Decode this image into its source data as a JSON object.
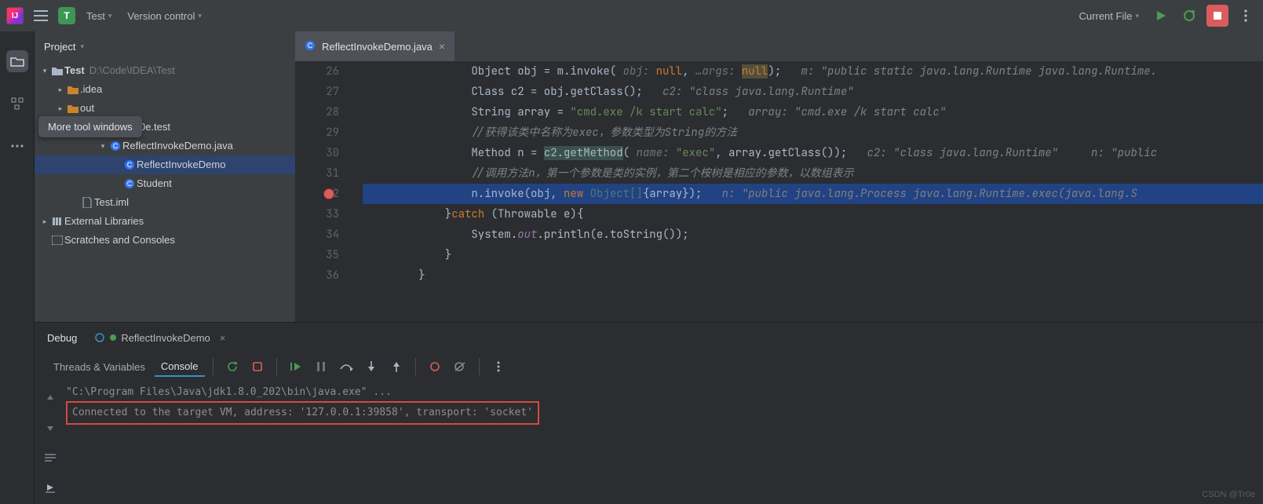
{
  "titlebar": {
    "project_badge": "T",
    "project_name": "Test",
    "vcs_label": "Version control",
    "run_config": "Current File"
  },
  "left_rail": {
    "tooltip": "More tool windows"
  },
  "project_tool": {
    "title": "Project",
    "tree": {
      "root_name": "Test",
      "root_path": "D:\\Code\\IDEA\\Test",
      "idea": ".idea",
      "out": "out",
      "pkg": "com.Tr0e.test",
      "file_java": "ReflectInvokeDemo.java",
      "cls_demo": "ReflectInvokeDemo",
      "cls_student": "Student",
      "iml": "Test.iml",
      "ext_libs": "External Libraries",
      "scratches": "Scratches and Consoles"
    }
  },
  "editor": {
    "tab_name": "ReflectInvokeDemo.java",
    "lines": {
      "26": {
        "indent": "                ",
        "pre": "Object obj = m.invoke( ",
        "p1": "obj: ",
        "v1": "null",
        "sep": ", ",
        "p2": "…args: ",
        "v2": "null",
        "post": ");   ",
        "hint": "m: \"public static java.lang.Runtime java.lang.Runtime."
      },
      "27": {
        "indent": "                ",
        "code": "Class c2 = obj.getClass();   ",
        "hint": "c2: \"class java.lang.Runtime\""
      },
      "28": {
        "indent": "                ",
        "pre": "String array = ",
        "str": "\"cmd.exe /k start calc\"",
        "post": ";   ",
        "hint": "array: \"cmd.exe /k start calc\""
      },
      "29": {
        "indent": "                ",
        "cmt": "//获得该类中名称为exec，参数类型为String的方法"
      },
      "30": {
        "indent": "                ",
        "pre": "Method n = ",
        "call": "c2.getMethod",
        "paren": "( ",
        "p1": "name: ",
        "str": "\"exec\"",
        "post": ", array.getClass());   ",
        "hint": "c2: \"class java.lang.Runtime\"     n: \"public"
      },
      "31": {
        "indent": "                ",
        "cmt": "//调用方法n，第一个参数是类的实例，第二个桉树是相应的参数，以数组表示"
      },
      "32": {
        "indent": "                ",
        "pre": "n.invoke(obj, ",
        "kw": "new ",
        "type": "Object[]",
        "post": "{array});   ",
        "hint": "n: \"public java.lang.Process java.lang.Runtime.exec(java.lang.S"
      },
      "33": {
        "indent": "            ",
        "pre": "}",
        "kw": "catch ",
        "post": "(Throwable e){"
      },
      "34": {
        "indent": "                ",
        "pre": "System.",
        "fld": "out",
        "post": ".println(e.toString());"
      },
      "35": {
        "indent": "            ",
        "txt": "}"
      },
      "36": {
        "indent": "        ",
        "txt": "}"
      }
    }
  },
  "debug": {
    "title": "Debug",
    "run_tab": "ReflectInvokeDemo",
    "subtab_threads": "Threads & Variables",
    "subtab_console": "Console",
    "console_line1": "\"C:\\Program Files\\Java\\jdk1.8.0_202\\bin\\java.exe\" ...",
    "console_line2": "Connected to the target VM, address: '127.0.0.1:39858', transport: 'socket'"
  },
  "watermark": "CSDN @Tr0e"
}
